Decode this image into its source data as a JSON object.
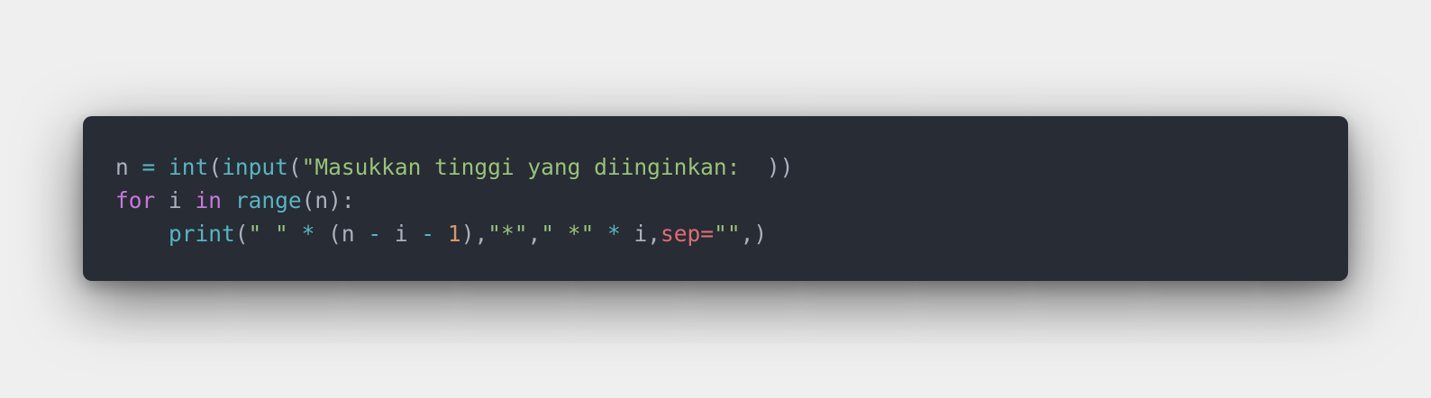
{
  "code_block": {
    "language": "python",
    "colors": {
      "background": "#282c34",
      "page_background": "#efefef",
      "plain": "#abb2bf",
      "operator": "#56b6c2",
      "builtin": "#56b6c2",
      "string": "#98c379",
      "keyword": "#c678dd",
      "number": "#d19a66",
      "parameter": "#e06c75"
    },
    "lines": [
      {
        "indent": "",
        "tokens": [
          {
            "text": "n ",
            "kind": "plain"
          },
          {
            "text": "=",
            "kind": "op"
          },
          {
            "text": " ",
            "kind": "plain"
          },
          {
            "text": "int",
            "kind": "builtin"
          },
          {
            "text": "(",
            "kind": "plain"
          },
          {
            "text": "input",
            "kind": "builtin"
          },
          {
            "text": "(",
            "kind": "plain"
          },
          {
            "text": "\"Masukkan tinggi yang diinginkan:  ",
            "kind": "string"
          },
          {
            "text": "))",
            "kind": "plain"
          }
        ]
      },
      {
        "indent": "",
        "tokens": [
          {
            "text": "for",
            "kind": "keyword"
          },
          {
            "text": " i ",
            "kind": "plain"
          },
          {
            "text": "in",
            "kind": "keyword"
          },
          {
            "text": " ",
            "kind": "plain"
          },
          {
            "text": "range",
            "kind": "builtin"
          },
          {
            "text": "(n):",
            "kind": "plain"
          }
        ]
      },
      {
        "indent": "    ",
        "tokens": [
          {
            "text": "print",
            "kind": "builtin"
          },
          {
            "text": "(",
            "kind": "plain"
          },
          {
            "text": "\" \"",
            "kind": "string"
          },
          {
            "text": " ",
            "kind": "plain"
          },
          {
            "text": "*",
            "kind": "op"
          },
          {
            "text": " (n ",
            "kind": "plain"
          },
          {
            "text": "-",
            "kind": "op"
          },
          {
            "text": " i ",
            "kind": "plain"
          },
          {
            "text": "-",
            "kind": "op"
          },
          {
            "text": " ",
            "kind": "plain"
          },
          {
            "text": "1",
            "kind": "number"
          },
          {
            "text": "),",
            "kind": "plain"
          },
          {
            "text": "\"*\"",
            "kind": "string"
          },
          {
            "text": ",",
            "kind": "plain"
          },
          {
            "text": "\" *\"",
            "kind": "string"
          },
          {
            "text": " ",
            "kind": "plain"
          },
          {
            "text": "*",
            "kind": "op"
          },
          {
            "text": " i,",
            "kind": "plain"
          },
          {
            "text": "sep=",
            "kind": "param"
          },
          {
            "text": "\"\"",
            "kind": "string"
          },
          {
            "text": ",)",
            "kind": "plain"
          }
        ]
      }
    ]
  }
}
